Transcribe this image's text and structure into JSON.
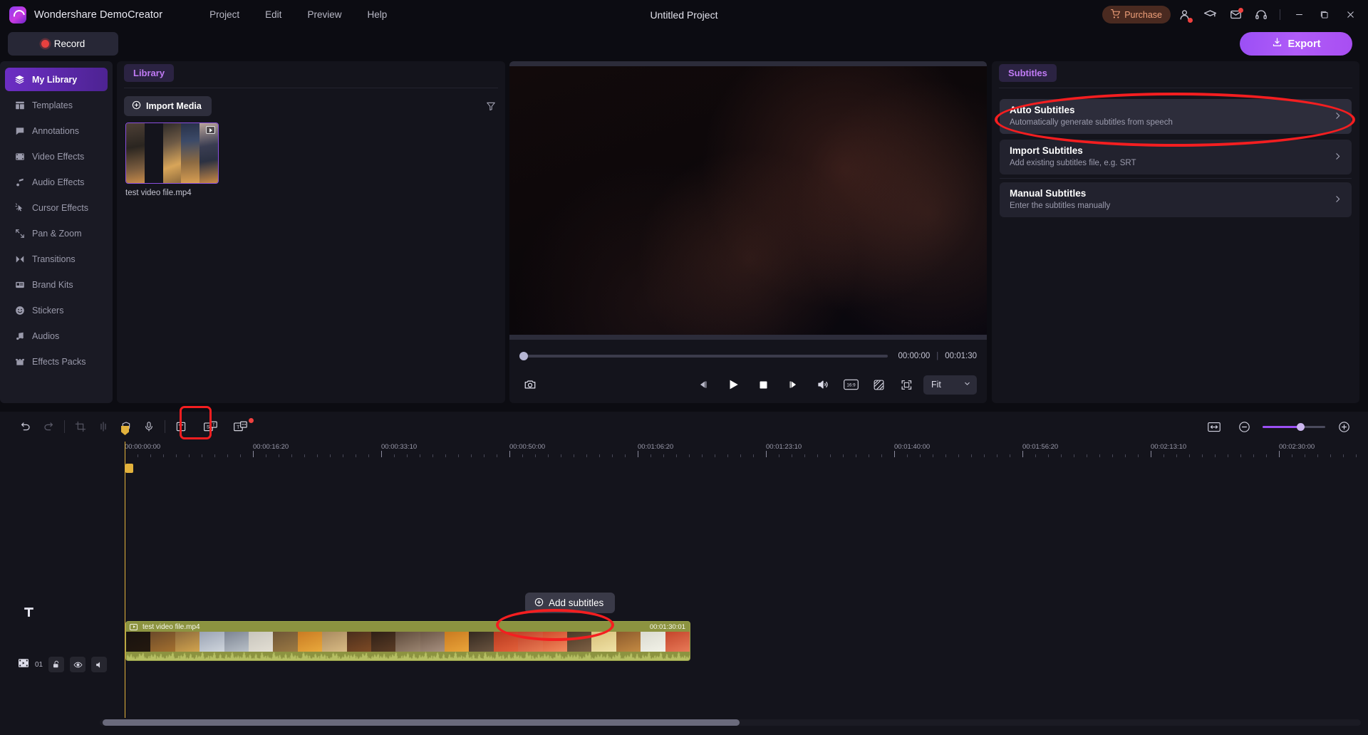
{
  "titlebar": {
    "app_name": "Wondershare DemoCreator",
    "menus": [
      "Project",
      "Edit",
      "Preview",
      "Help"
    ],
    "project_title": "Untitled Project",
    "purchase_label": "Purchase",
    "icons": [
      "account-icon",
      "academy-icon",
      "mail-icon",
      "support-icon",
      "minimize-icon",
      "maximize-icon",
      "close-icon"
    ]
  },
  "actionbar": {
    "record_label": "Record",
    "export_label": "Export"
  },
  "sidebar": {
    "items": [
      {
        "label": "My Library",
        "icon": "layers-icon",
        "active": true
      },
      {
        "label": "Templates",
        "icon": "template-icon",
        "active": false
      },
      {
        "label": "Annotations",
        "icon": "annotation-icon",
        "active": false
      },
      {
        "label": "Video Effects",
        "icon": "video-effects-icon",
        "active": false
      },
      {
        "label": "Audio Effects",
        "icon": "audio-effects-icon",
        "active": false
      },
      {
        "label": "Cursor Effects",
        "icon": "cursor-effects-icon",
        "active": false
      },
      {
        "label": "Pan & Zoom",
        "icon": "pan-zoom-icon",
        "active": false
      },
      {
        "label": "Transitions",
        "icon": "transitions-icon",
        "active": false
      },
      {
        "label": "Brand Kits",
        "icon": "brand-kits-icon",
        "active": false
      },
      {
        "label": "Stickers",
        "icon": "sticker-icon",
        "active": false
      },
      {
        "label": "Audios",
        "icon": "music-note-icon",
        "active": false
      },
      {
        "label": "Effects Packs",
        "icon": "effects-pack-icon",
        "active": false
      }
    ]
  },
  "library": {
    "tab_label": "Library",
    "import_label": "Import Media",
    "filter_icon": "filter-icon",
    "media": [
      {
        "name": "test video file.mp4",
        "badge": "video-badge"
      }
    ]
  },
  "preview": {
    "current_time": "00:00:00",
    "total_time": "00:01:30",
    "time_separator": "|",
    "progress_percent": 0,
    "snapshot_icon": "camera-icon",
    "controls": [
      "prev-frame-icon",
      "play-icon",
      "stop-icon",
      "next-frame-icon"
    ],
    "right_controls": [
      "volume-icon",
      "aspect-ratio-icon",
      "transparency-icon",
      "fullscreen-icon"
    ],
    "aspect_label": "16:9",
    "fit_value": "Fit"
  },
  "subtitles_panel": {
    "tab_label": "Subtitles",
    "options": [
      {
        "title": "Auto Subtitles",
        "desc": "Automatically generate subtitles from speech",
        "highlighted": true
      },
      {
        "title": "Import Subtitles",
        "desc": "Add existing subtitles file, e.g. SRT",
        "highlighted": false
      },
      {
        "title": "Manual Subtitles",
        "desc": "Enter the subtitles manually",
        "highlighted": false
      }
    ]
  },
  "timeline": {
    "toolbar_icons": [
      "undo-icon",
      "redo-icon",
      "crop-icon",
      "split-icon",
      "shield-icon",
      "microphone-icon",
      "text-icon",
      "subtitle-icon",
      "caption-icon"
    ],
    "subtitle_icon_highlighted": true,
    "caption_icon_badge": true,
    "right_icons": [
      "fit-timeline-icon",
      "zoom-out-icon",
      "zoom-in-icon"
    ],
    "zoom_level_percent": 60,
    "ruler_labels": [
      "00:00:00:00",
      "00:00:16:20",
      "00:00:33:10",
      "00:00:50:00",
      "00:01:06:20",
      "00:01:23:10",
      "00:01:40:00",
      "00:01:56:20",
      "00:02:13:10",
      "00:02:30:00"
    ],
    "add_track_icon": "add-track-icon",
    "text_track_icon": "text-track-icon",
    "track_number": "01",
    "track_controls": [
      "video-track-icon",
      "unlock-icon",
      "eye-icon",
      "speaker-icon"
    ],
    "add_subtitles_label": "Add subtitles",
    "clip": {
      "name": "test video file.mp4",
      "duration": "00:01:30:01",
      "icon": "clip-video-icon"
    }
  },
  "annotations": {
    "highlight_color": "#f41e20"
  }
}
